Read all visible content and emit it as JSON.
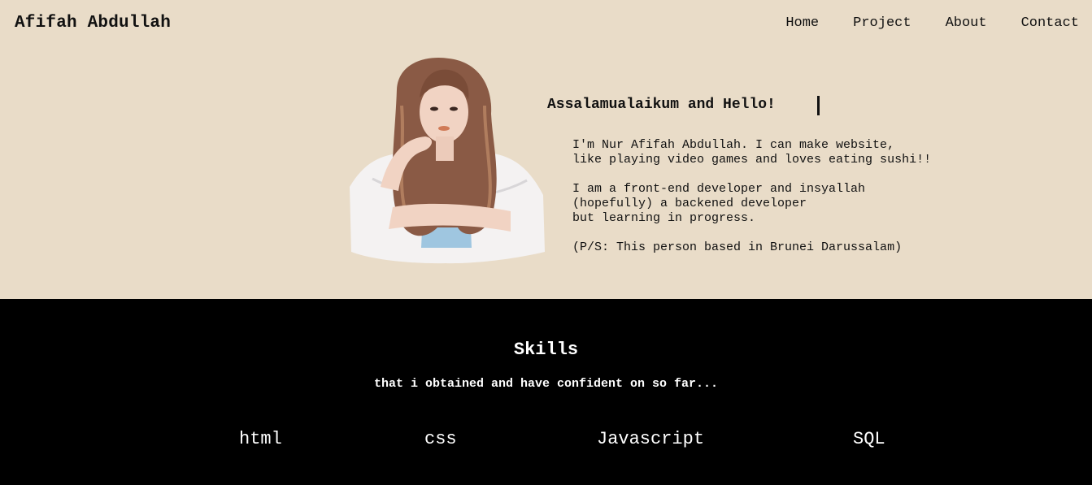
{
  "header": {
    "brand": "Afifah Abdullah",
    "nav": [
      "Home",
      "Project",
      "About",
      "Contact"
    ]
  },
  "hero": {
    "greeting": "Assalamualaikum and Hello!",
    "bio": [
      "I'm Nur Afifah Abdullah. I can make website,",
      "like playing video games and loves eating sushi!!",
      "",
      "I am a front-end developer and insyallah",
      "(hopefully) a backened developer",
      "but learning in progress.",
      "",
      "(P/S: This person based in Brunei Darussalam)"
    ]
  },
  "skills": {
    "title": "Skills",
    "subtitle": "that i obtained and have confident on so far...",
    "items": [
      "html",
      "css",
      "Javascript",
      "SQL"
    ]
  },
  "colors": {
    "background": "#e9dcc8",
    "skills_background": "#000000",
    "text": "#111111"
  }
}
